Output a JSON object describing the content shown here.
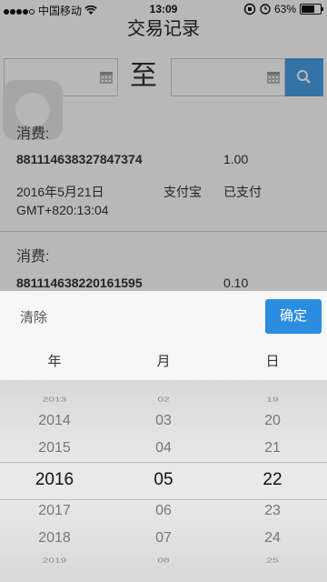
{
  "status_bar": {
    "carrier": "中国移动",
    "time": "13:09",
    "battery": "63%",
    "battery_level": 0.63
  },
  "header": {
    "title": "交易记录"
  },
  "filter": {
    "to_label": "至",
    "start_date": "",
    "end_date": ""
  },
  "records": [
    {
      "label": "消费:",
      "order_id": "881114638327847374",
      "amount": "1.00",
      "date": "2016年5月21日",
      "method": "支付宝",
      "status": "已支付",
      "gmt": "GMT+820:13:04"
    },
    {
      "label": "消费:",
      "order_id": "881114638220161595",
      "amount": "0.10"
    }
  ],
  "picker": {
    "clear_label": "清除",
    "confirm_label": "确定",
    "headers": [
      "年",
      "月",
      "日"
    ],
    "years": [
      "2013",
      "2014",
      "2015",
      "2016",
      "2017",
      "2018",
      "2019"
    ],
    "months": [
      "02",
      "03",
      "04",
      "05",
      "06",
      "07",
      "08"
    ],
    "days": [
      "19",
      "20",
      "21",
      "22",
      "23",
      "24",
      "25"
    ]
  },
  "colors": {
    "accent": "#2a8de0",
    "search_button": "#4a9fe6"
  }
}
